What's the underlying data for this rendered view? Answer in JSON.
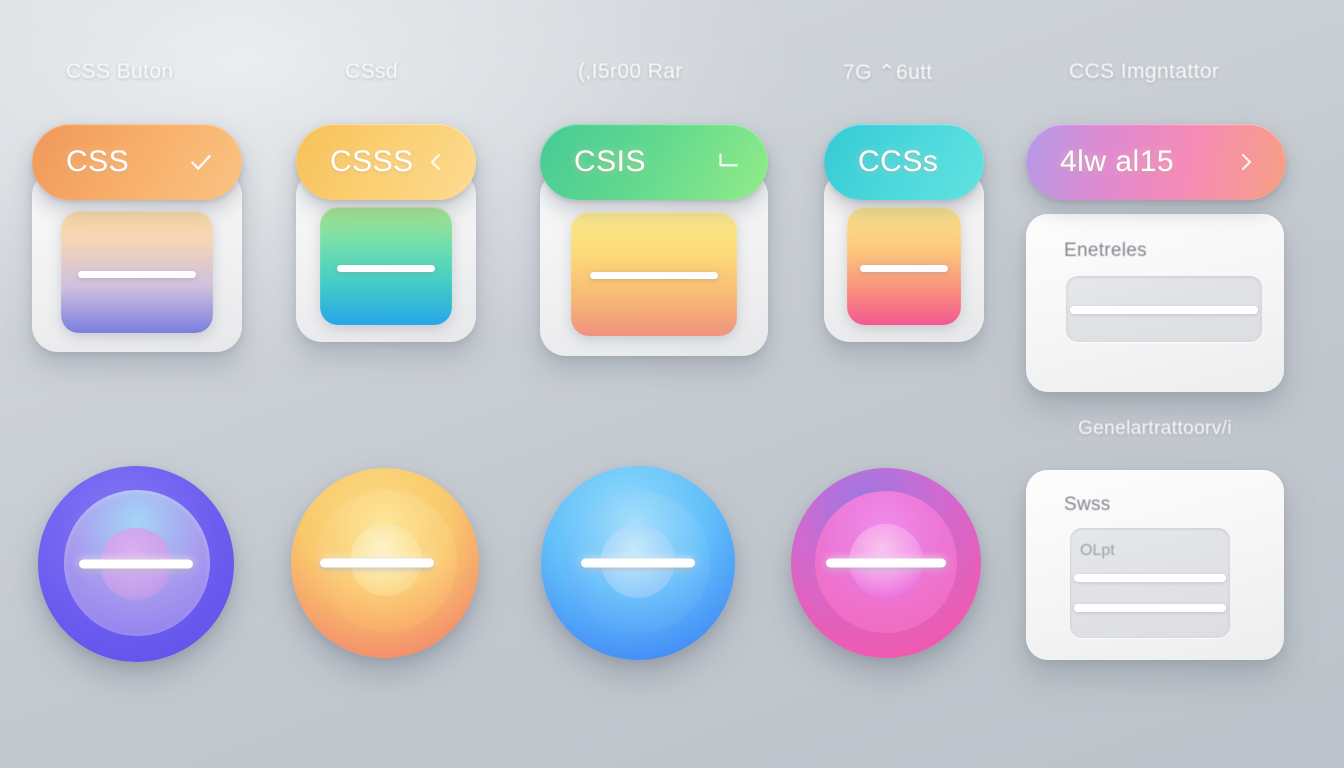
{
  "background": {
    "base_color": "#c9ced4",
    "highlight_color": "#dfe3e7"
  },
  "columns": [
    {
      "header": "CSS Buton",
      "pill": {
        "label": "CSS",
        "icon": "check-icon",
        "gradient_from": "#f2a05a",
        "gradient_to": "#fbc07e"
      },
      "tile": {
        "gradient_from": "#fbd9a4",
        "gradient_mid": "#e2c3d6",
        "gradient_to": "#7b7ede"
      }
    },
    {
      "header": "CSsd",
      "pill": {
        "label": "CSSS",
        "icon": "chevron-left-icon",
        "gradient_from": "#f6c25a",
        "gradient_to": "#fcd98c"
      },
      "tile": {
        "gradient_from": "#a8e88c",
        "gradient_mid": "#56d2bb",
        "gradient_to": "#26a6e8"
      }
    },
    {
      "header": "(,I5r00 Rar",
      "pill": {
        "label": "CSIS",
        "icon": "enter-arrow-icon",
        "gradient_from": "#4ccf92",
        "gradient_to": "#8ceb8a"
      },
      "tile": {
        "gradient_from": "#fbe98e",
        "gradient_mid": "#fbc96a",
        "gradient_to": "#f0907f"
      }
    },
    {
      "header": "7G ⌃6utt",
      "pill": {
        "label": "CCSs",
        "icon": "none",
        "gradient_from": "#3ccfd6",
        "gradient_to": "#5fe0e0"
      },
      "tile": {
        "gradient_from": "#fbe48c",
        "gradient_mid": "#fbb07e",
        "gradient_to": "#f4588f"
      }
    }
  ],
  "right_column": {
    "header": "CCS Imgntattor",
    "pill": {
      "label": "4lw al15",
      "icon": "chevron-right-icon",
      "gradient_from": "#b49ae6",
      "gradient_mid": "#f48fc4",
      "gradient_to": "#f7a083"
    },
    "top_panel": {
      "label": "Enetreles",
      "field_text": "",
      "bar_count": 1
    },
    "section_header": "Genelartrattoorv/i",
    "bottom_panel": {
      "label": "Swss",
      "field_text": "OLpt",
      "bar_count": 2
    }
  },
  "circles": [
    {
      "name": "purple",
      "outer_from": "#6c5df0",
      "outer_to": "#7b6bf5",
      "mid_from": "#9ecdf5",
      "mid_to": "#8b7bf0",
      "core_from": "#d8a8ec",
      "core_to": "#b79ae8"
    },
    {
      "name": "orange",
      "outer_from": "#f9d36a",
      "outer_to": "#ef7b6c",
      "mid_from": "#fbdf8c",
      "mid_to": "#f79a62",
      "core_from": "#fdf0c0",
      "core_to": "#fbc87a"
    },
    {
      "name": "blue",
      "outer_from": "#7ed4fb",
      "outer_to": "#3a7df5",
      "mid_from": "#9adcfb",
      "mid_to": "#4a93f7",
      "core_from": "#bfe6fc",
      "core_to": "#82bdf9"
    },
    {
      "name": "pink",
      "outer_from": "#8a6ee0",
      "outer_to": "#f05ab0",
      "mid_from": "#e87ae8",
      "mid_to": "#f468b4",
      "core_from": "#f9b4e8",
      "core_to": "#e858d8"
    }
  ]
}
